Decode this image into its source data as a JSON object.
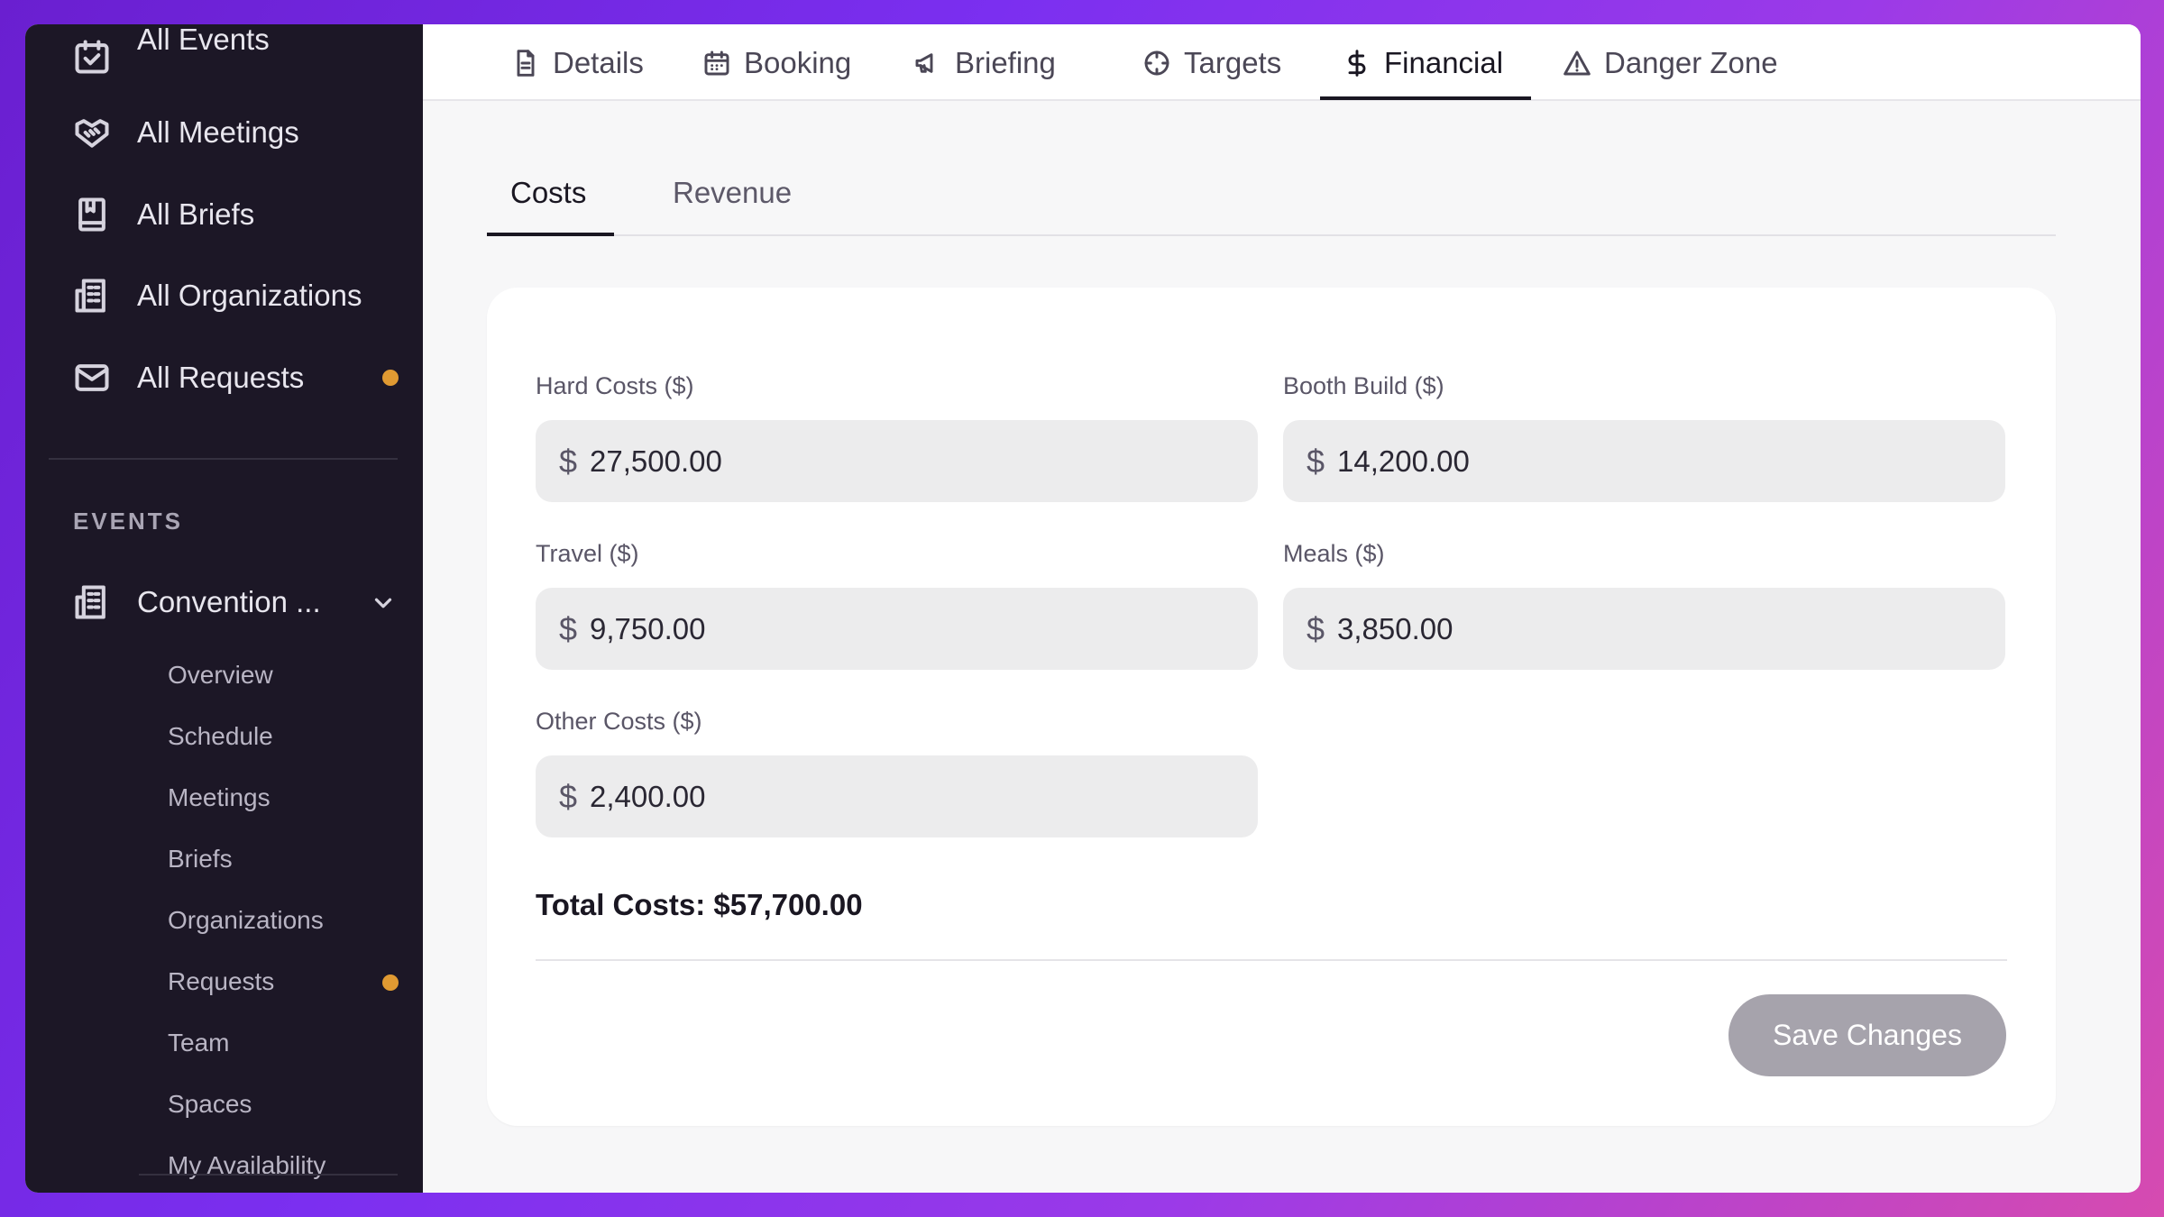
{
  "sidebar": {
    "items": [
      {
        "label": "All Events"
      },
      {
        "label": "All Meetings"
      },
      {
        "label": "All Briefs"
      },
      {
        "label": "All Organizations"
      },
      {
        "label": "All Requests"
      }
    ],
    "section_label": "EVENTS",
    "event_selector": "Convention ...",
    "sub_items": [
      {
        "label": "Overview"
      },
      {
        "label": "Schedule"
      },
      {
        "label": "Meetings"
      },
      {
        "label": "Briefs"
      },
      {
        "label": "Organizations"
      },
      {
        "label": "Requests"
      },
      {
        "label": "Team"
      },
      {
        "label": "Spaces"
      },
      {
        "label": "My Availability"
      }
    ],
    "notification_color": "#e09a32"
  },
  "top_tabs": [
    {
      "label": "Details",
      "icon": "document-icon"
    },
    {
      "label": "Booking",
      "icon": "calendar-icon"
    },
    {
      "label": "Briefing",
      "icon": "megaphone-icon"
    },
    {
      "label": "Targets",
      "icon": "crosshair-icon"
    },
    {
      "label": "Financial",
      "icon": "dollar-icon",
      "active": true
    },
    {
      "label": "Danger Zone",
      "icon": "warning-icon"
    }
  ],
  "sub_tabs": [
    {
      "label": "Costs",
      "active": true
    },
    {
      "label": "Revenue"
    }
  ],
  "costs": {
    "currency_symbol": "$",
    "fields": [
      {
        "label": "Hard Costs ($)",
        "value": "27,500.00"
      },
      {
        "label": "Booth Build ($)",
        "value": "14,200.00"
      },
      {
        "label": "Travel ($)",
        "value": "9,750.00"
      },
      {
        "label": "Meals ($)",
        "value": "3,850.00"
      },
      {
        "label": "Other Costs ($)",
        "value": "2,400.00"
      }
    ],
    "total": "Total Costs: $57,700.00",
    "save_label": "Save Changes"
  }
}
